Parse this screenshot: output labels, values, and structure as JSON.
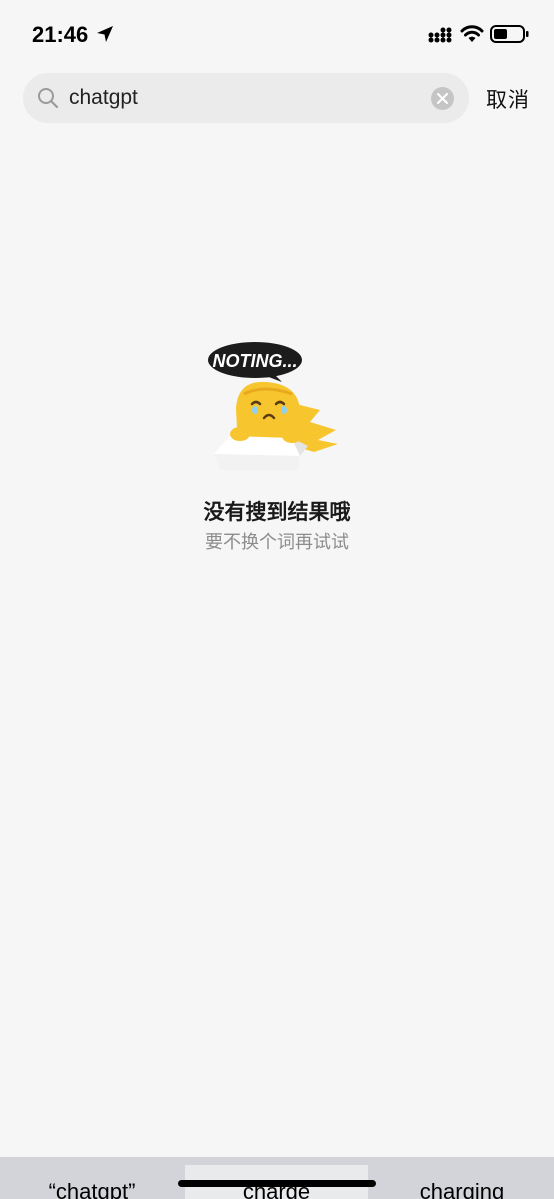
{
  "status_bar": {
    "time": "21:46",
    "icons": [
      "location-arrow-icon",
      "cellular-signal-icon",
      "wifi-icon",
      "battery-icon"
    ]
  },
  "search": {
    "value": "chatgpt",
    "cancel_label": "取消"
  },
  "empty_state": {
    "badge_text": "NOTING...",
    "title": "没有搜到结果哦",
    "subtitle": "要不换个词再试试"
  },
  "keyboard_suggestions": [
    {
      "label": "“chatgpt”"
    },
    {
      "label": "charge"
    },
    {
      "label": "charging"
    }
  ],
  "colors": {
    "background": "#f6f6f6",
    "search_field": "#ebebeb",
    "mascot_yellow": "#f7c62f",
    "subtitle_gray": "#8c8c8c",
    "keyboard_bar": "#d2d4d9"
  }
}
